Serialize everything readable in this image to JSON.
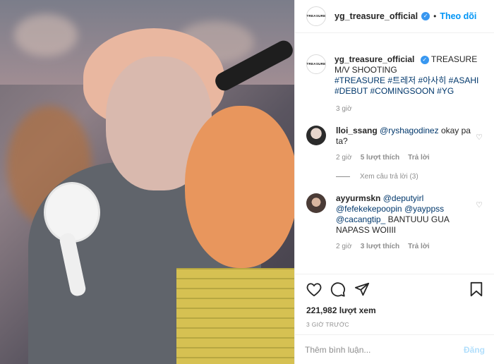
{
  "post": {
    "username": "yg_treasure_official",
    "follow_label": "Theo dõi",
    "logo_text": "TREASURE",
    "caption_parts": {
      "text1": "TREASURE M/V SHOOTING",
      "tags": [
        "#TREASURE",
        "#트레저",
        "#아사히",
        "#ASAHI",
        "#DEBUT",
        "#COMINGSOON",
        "#YG"
      ]
    },
    "time": "3 giờ"
  },
  "comments": [
    {
      "user": "lloi_ssang",
      "mention": "@ryshagodinez",
      "text": "okay pa ta?",
      "time": "2 giờ",
      "likes": "5 lượt thích",
      "reply": "Trả lời",
      "view_replies": "Xem câu trả lời (3)"
    },
    {
      "user": "ayyurmskn",
      "mentions": [
        "@deputyirl",
        "@fefekekepoopin",
        "@yayppss",
        "@cacangtip_"
      ],
      "text": "BANTUUU GUA NAPASS WOIIII",
      "time": "2 giờ",
      "likes": "3 lượt thích",
      "reply": "Trả lời"
    }
  ],
  "actions": {
    "views": "221,982 lượt xem",
    "ago": "3 GIỜ TRƯỚC",
    "add_comment_placeholder": "Thêm bình luận...",
    "post_label": "Đăng"
  },
  "icons": [
    "heart-icon",
    "comment-icon",
    "share-icon",
    "bookmark-icon",
    "verified-badge-icon"
  ]
}
